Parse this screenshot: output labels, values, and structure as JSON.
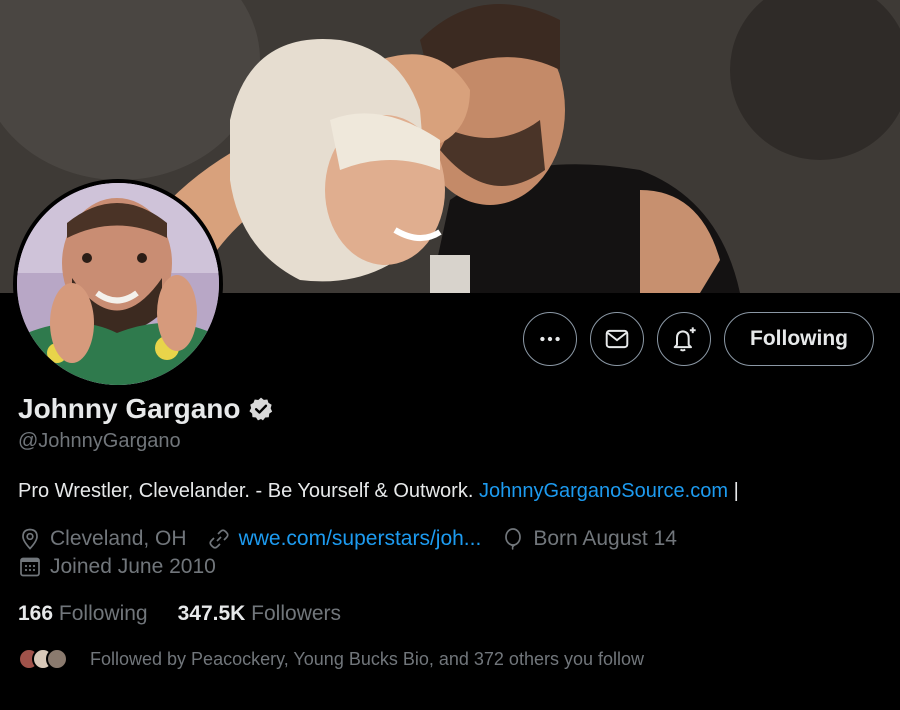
{
  "profile": {
    "name": "Johnny Gargano",
    "handle": "@JohnnyGargano",
    "bio_text": "Pro Wrestler, Clevelander. - Be Yourself & Outwork.",
    "bio_link": "JohnnyGarganoSource.com",
    "bio_tail": "|",
    "location": "Cleveland, OH",
    "website": "wwe.com/superstars/joh...",
    "birthday": "Born August 14",
    "joined": "Joined June 2010"
  },
  "stats": {
    "following_count": "166",
    "following_label": "Following",
    "followers_count": "347.5K",
    "followers_label": "Followers"
  },
  "followed_by": "Followed by Peacockery, Young Bucks Bio, and 372 others you follow",
  "actions": {
    "following_button": "Following"
  },
  "icons": [
    "more-icon",
    "mail-icon",
    "notification-bell-icon",
    "verified-badge-icon",
    "location-icon",
    "link-icon",
    "balloon-icon",
    "calendar-icon"
  ],
  "colors": {
    "background": "#000000",
    "text": "#e7e9ea",
    "secondary": "#71767b",
    "link": "#1d9bf0"
  }
}
